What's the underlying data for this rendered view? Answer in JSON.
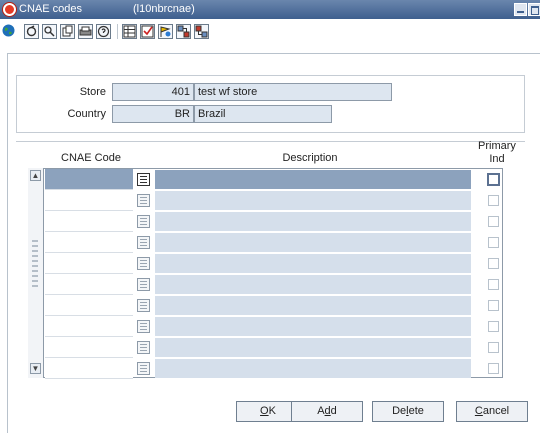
{
  "window": {
    "title": "CNAE codes",
    "code": "(l10nbrcnae)",
    "accent": "#3e5f8e"
  },
  "toolbar": {
    "icons": [
      "globe-icon",
      "back-icon",
      "search-icon",
      "copy-icon",
      "print-icon",
      "help-icon",
      "grid-icon",
      "check-icon",
      "flag-icon",
      "expand-icon",
      "collapse-icon"
    ]
  },
  "header": {
    "store_label": "Store",
    "store_id": "401",
    "store_name": "test wf store",
    "country_label": "Country",
    "country_code": "BR",
    "country_name": "Brazil"
  },
  "grid": {
    "columns": {
      "code": "CNAE Code",
      "description": "Description",
      "primary_line1": "Primary",
      "primary_line2": "Ind"
    },
    "selected_color": "#8ca2bd",
    "row_count": 10
  },
  "buttons": {
    "ok_pre": "",
    "ok_u": "O",
    "ok_post": "K",
    "add_pre": "A",
    "add_u": "d",
    "add_post": "d",
    "delete_pre": "De",
    "delete_u": "l",
    "delete_post": "ete",
    "cancel_pre": "",
    "cancel_u": "C",
    "cancel_post": "ancel"
  }
}
